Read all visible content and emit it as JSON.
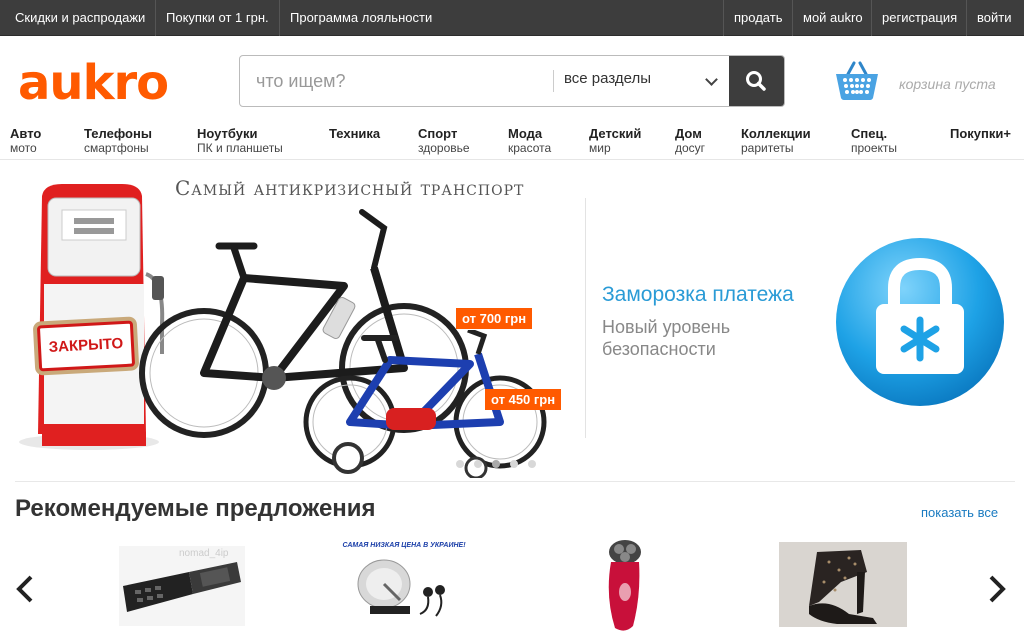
{
  "topbar": {
    "left_links": [
      "Скидки и распродажи",
      "Покупки от 1 грн.",
      "Программа лояльности"
    ],
    "right_links": [
      "продать",
      "мой aukro",
      "регистрация",
      "войти"
    ]
  },
  "header": {
    "logo": "aukro",
    "search_placeholder": "что ищем?",
    "category_selected": "все разделы",
    "cart_text": "корзина пуста"
  },
  "categories": [
    {
      "title": "Авто",
      "sub": "мото"
    },
    {
      "title": "Телефоны",
      "sub": "смартфоны"
    },
    {
      "title": "Ноутбуки",
      "sub": "ПК и планшеты"
    },
    {
      "title": "Техника",
      "sub": ""
    },
    {
      "title": "Спорт",
      "sub": "здоровье"
    },
    {
      "title": "Мода",
      "sub": "красота"
    },
    {
      "title": "Детский",
      "sub": "мир"
    },
    {
      "title": "Дом",
      "sub": "досуг"
    },
    {
      "title": "Коллекции",
      "sub": "раритеты"
    },
    {
      "title": "Спец.",
      "sub": "проекты"
    },
    {
      "title": "Покупки+",
      "sub": ""
    }
  ],
  "banner": {
    "title": "Самый антикризисный транспорт",
    "pump_sign": "ЗАКРЫТО",
    "price_big": "от 700 грн",
    "price_small": "от 450 грн",
    "freeze_title": "Заморозка платежа",
    "freeze_subtitle": "Новый уровень безопасности",
    "dots_count": 5,
    "active_dot": 2
  },
  "recommended": {
    "title": "Рекомендуемые предложения",
    "show_all": "показать все",
    "product_overlay_text": "САМАЯ НИЗКАЯ ЦЕНА В УКРАИНЕ!",
    "watermark": "nomad_4ip"
  },
  "colors": {
    "brand": "#ff5a00",
    "topbar": "#3d3d3d",
    "accent_blue": "#2a9bd6",
    "link_blue": "#1a7bc1"
  }
}
